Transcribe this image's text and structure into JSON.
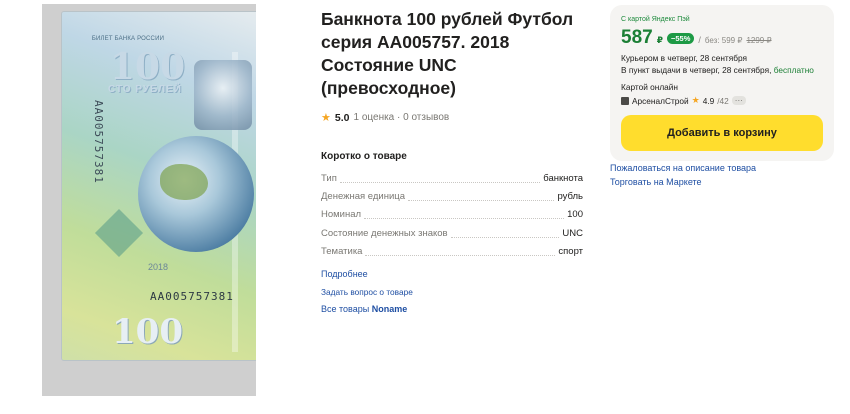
{
  "product": {
    "title": "Банкнота 100 рублей Футбол серия АА005757. 2018 Состояние UNC (превосходное)",
    "rating_value": "5.0",
    "rating_meta": "1 оценка · 0 отзывов",
    "banknote": {
      "bank_text": "БИЛЕТ БАНКА РОССИИ",
      "denomination": "100",
      "currency_text": "СТО РУБЛЕЙ",
      "serial": "АА005757381",
      "year_text": "2018"
    }
  },
  "specs": {
    "title": "Коротко о товаре",
    "items": [
      {
        "key": "Тип",
        "value": "банкнота"
      },
      {
        "key": "Денежная единица",
        "value": "рубль"
      },
      {
        "key": "Номинал",
        "value": "100"
      },
      {
        "key": "Состояние денежных знаков",
        "value": "UNC"
      },
      {
        "key": "Тематика",
        "value": "спорт"
      }
    ],
    "more_link": "Подробнее",
    "ask_link": "Задать вопрос о товаре",
    "all_goods_prefix": "Все товары",
    "all_goods_brand": "Noname"
  },
  "buybox": {
    "card_label": "С картой Яндекс Пэй",
    "price": "587",
    "currency": "₽",
    "discount": "−55%",
    "separator": "/",
    "without_label": "без: 599 ₽",
    "old_price": "1299 ₽",
    "delivery_courier": "Курьером в четверг, 28 сентября",
    "delivery_pickup": "В пункт выдачи в четверг, 28 сентября,",
    "delivery_pickup_free": "бесплатно",
    "payment": "Картой онлайн",
    "seller_name": "АрсеналСтрой",
    "seller_rating": "4.9",
    "seller_reviews": "/42",
    "seller_more": "···",
    "cart_button": "Добавить в корзину"
  },
  "side_links": {
    "complain": "Пожаловаться на описание товара",
    "sell": "Торговать на Маркете"
  },
  "colors": {
    "price_green": "#1b7f35",
    "button_yellow": "#ffdd2d",
    "link_blue": "#1f4fa3",
    "star": "#f5a623"
  }
}
